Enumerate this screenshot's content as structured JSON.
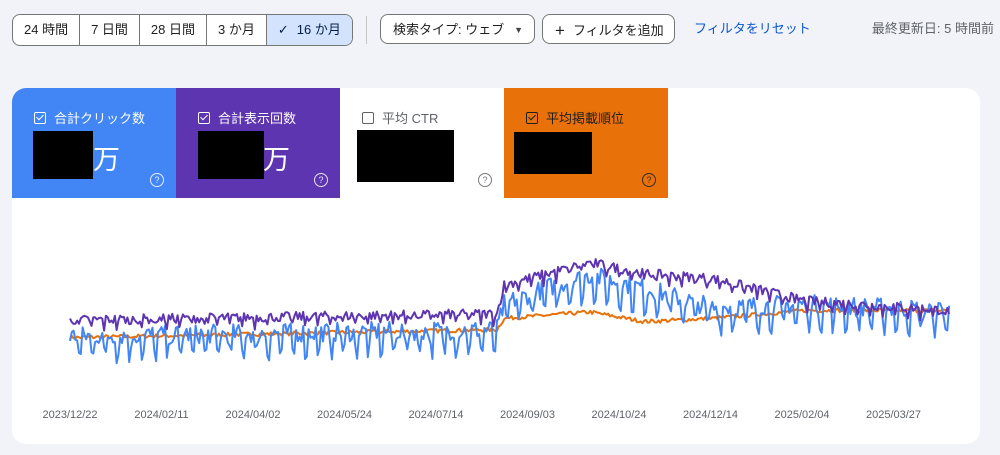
{
  "toolbar": {
    "ranges": [
      "24 時間",
      "7 日間",
      "28 日間",
      "3 か月",
      "16 か月"
    ],
    "active_range": "16 か月",
    "search_type": "検索タイプ: ウェブ",
    "add_filter": "フィルタを追加",
    "reset_filter": "フィルタをリセット",
    "last_updated": "最終更新日: 5 時間前"
  },
  "metrics": {
    "clicks": {
      "label": "合計クリック数",
      "unit": "万",
      "checked": true,
      "color": "#4285f4"
    },
    "impressions": {
      "label": "合計表示回数",
      "unit": "万",
      "checked": true,
      "color": "#5e35b1"
    },
    "ctr": {
      "label": "平均 CTR",
      "checked": false
    },
    "position": {
      "label": "平均掲載順位",
      "checked": true,
      "color": "#e8710a"
    }
  },
  "chart_data": {
    "type": "line",
    "x_ticks": [
      "2023/12/22",
      "2024/02/11",
      "2024/04/02",
      "2024/05/24",
      "2024/07/14",
      "2024/09/03",
      "2024/10/24",
      "2024/12/14",
      "2025/02/04",
      "2025/03/27"
    ],
    "y_axis": "hidden",
    "grid": false,
    "series": [
      {
        "name": "合計表示回数",
        "color": "#5e35b1",
        "pattern": "sawtooth",
        "x": [
          "2023/12/22",
          "2024/08/16",
          "2024/08/20",
          "2024/10/07",
          "2024/11/06",
          "2024/12/14",
          "2025/02/04",
          "2025/04/25"
        ],
        "values": [
          0.34,
          0.38,
          0.56,
          0.7,
          0.63,
          0.6,
          0.46,
          0.4
        ]
      },
      {
        "name": "合計クリック数",
        "color": "#4285f4",
        "pattern": "weekly",
        "x": [
          "2023/12/22",
          "2024/08/16",
          "2024/08/20",
          "2024/09/12",
          "2024/10/07",
          "2024/11/06",
          "2024/12/14",
          "2025/02/04",
          "2025/04/25"
        ],
        "values": [
          0.22,
          0.26,
          0.42,
          0.52,
          0.6,
          0.52,
          0.4,
          0.42,
          0.38
        ]
      },
      {
        "name": "平均掲載順位",
        "color": "#e8710a",
        "pattern": "smooth",
        "x": [
          "2023/12/22",
          "2024/08/16",
          "2024/08/20",
          "2024/10/07",
          "2024/11/06",
          "2024/12/14",
          "2025/02/04",
          "2025/04/25"
        ],
        "values": [
          0.24,
          0.29,
          0.36,
          0.4,
          0.34,
          0.36,
          0.41,
          0.41
        ]
      }
    ]
  }
}
